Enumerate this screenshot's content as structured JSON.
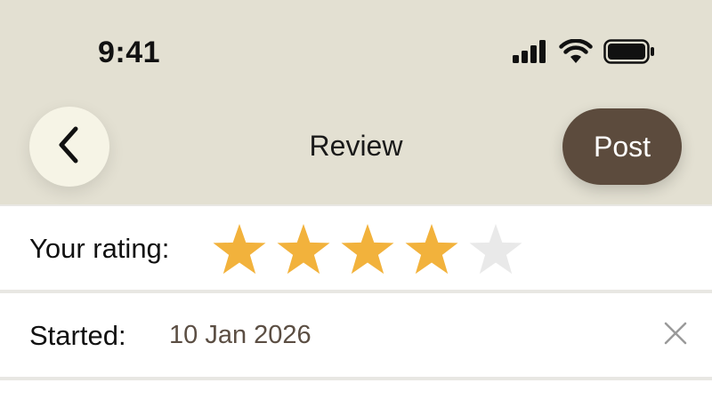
{
  "status_bar": {
    "time": "9:41",
    "icons": [
      "cellular-signal-icon",
      "wifi-icon",
      "battery-icon"
    ]
  },
  "nav": {
    "title": "Review",
    "back_icon": "chevron-left-icon",
    "post_label": "Post"
  },
  "rating": {
    "label": "Your rating:",
    "value": 4,
    "max": 5,
    "filled_color": "#f2b23c",
    "empty_color": "#e9e9e9"
  },
  "started": {
    "label": "Started:",
    "value": "10 Jan 2026",
    "clear_icon": "close-icon"
  },
  "colors": {
    "header_bg": "#e3e0d2",
    "post_button_bg": "#5c4b3d",
    "back_button_bg": "#f6f4e6",
    "date_text": "#5b4e43"
  }
}
